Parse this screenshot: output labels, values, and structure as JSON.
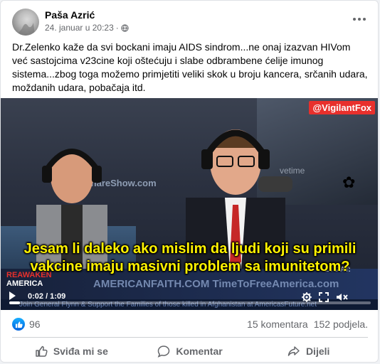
{
  "post": {
    "author": "Paša Azrić",
    "timestamp": "24. januar u 20:23",
    "separator": "·",
    "text": "Dr.Zelenko kaže da svi bockani imaju AIDS sindrom...ne onaj izazvan HIVom već sastojcima v23cine koji oštećuju i slabe odbrambene ćelije imunog sistema...zbog toga možemo primjetiti veliki skok u broju kancera, srčanih udara, moždanih udara, pobačaja itd."
  },
  "video": {
    "brand_tag": "@VigilantFox",
    "subtitle": "Jesam li daleko ako mislim da ljudi koji su primili vakcine imaju masivni problem sa imunitetom?",
    "screen_text_left": "ShareShow.com",
    "screen_text_right": "vetime",
    "awaken_1": "REAWAKEN",
    "awaken_2": "AMERICA",
    "url_overlay": "AMERICANFAITH.COM   TimeToFreeAmerica.com",
    "nets": "ETS AT:",
    "ticker": "Join General Flynn & Support the Families of those killed in Afghanistan at AmericasFuture.net",
    "time_display": "0:02 / 1:09",
    "progress": 0.03
  },
  "stats": {
    "likes": "96",
    "comments": "15 komentara",
    "shares": "152 podjela."
  },
  "actions": {
    "like": "Sviđa mi se",
    "comment": "Komentar",
    "share": "Dijeli"
  },
  "colors": {
    "brand_red": "#e8302c",
    "subtitle_yellow": "#fff200",
    "like_blue": "#1877f2"
  }
}
